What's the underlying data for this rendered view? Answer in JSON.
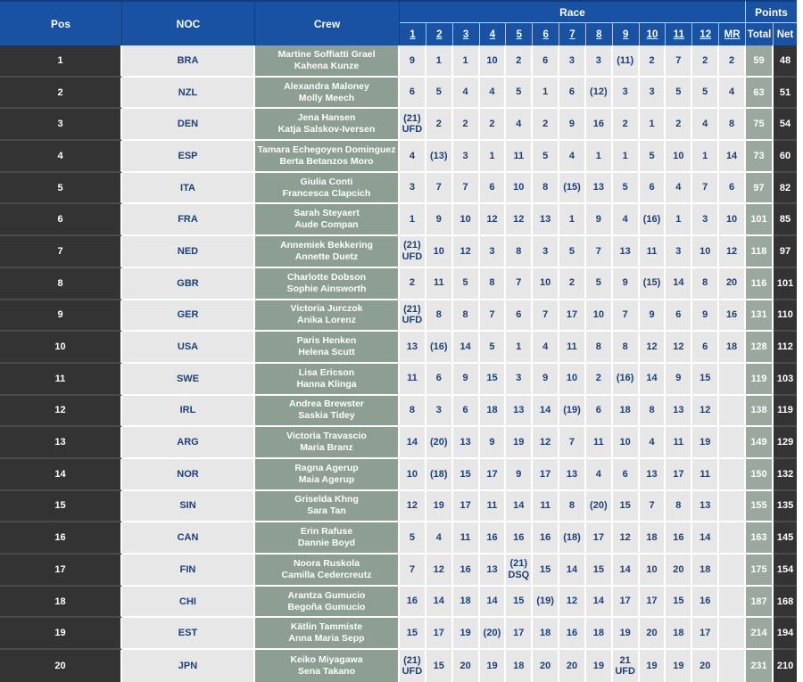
{
  "colors": {
    "header_blue": "#1951a3",
    "header_blue_dark": "#143d7d",
    "dark_cell": "#333333",
    "dark_divider": "#4b4b4b",
    "light_cell": "#e7e7e7",
    "crew_green": "#8d9e92",
    "total_green": "#9aa89d",
    "navy_text": "#1d4078"
  },
  "header": {
    "pos": "Pos",
    "noc": "NOC",
    "crew": "Crew",
    "race": "Race",
    "points": "Points",
    "race_cols": [
      "1",
      "2",
      "3",
      "4",
      "5",
      "6",
      "7",
      "8",
      "9",
      "10",
      "11",
      "12",
      "MR"
    ],
    "total": "Total",
    "net": "Net"
  },
  "rows": [
    {
      "pos": "1",
      "noc": "BRA",
      "crew": [
        "Martine Soffiatti Grael",
        "Kahena Kunze"
      ],
      "races": [
        "9",
        "1",
        "1",
        "10",
        "2",
        "6",
        "3",
        "3",
        "(11)",
        "2",
        "7",
        "2",
        "2"
      ],
      "total": "59",
      "net": "48"
    },
    {
      "pos": "2",
      "noc": "NZL",
      "crew": [
        "Alexandra Maloney",
        "Molly Meech"
      ],
      "races": [
        "6",
        "5",
        "4",
        "4",
        "5",
        "1",
        "6",
        "(12)",
        "3",
        "3",
        "5",
        "5",
        "4"
      ],
      "total": "63",
      "net": "51"
    },
    {
      "pos": "3",
      "noc": "DEN",
      "crew": [
        "Jena Hansen",
        "Katja Salskov-Iversen"
      ],
      "races": [
        "(21)\nUFD",
        "2",
        "2",
        "2",
        "4",
        "2",
        "9",
        "16",
        "2",
        "1",
        "2",
        "4",
        "8"
      ],
      "total": "75",
      "net": "54"
    },
    {
      "pos": "4",
      "noc": "ESP",
      "crew": [
        "Tamara Echegoyen Dominguez",
        "Berta Betanzos Moro"
      ],
      "races": [
        "4",
        "(13)",
        "3",
        "1",
        "11",
        "5",
        "4",
        "1",
        "1",
        "5",
        "10",
        "1",
        "14"
      ],
      "total": "73",
      "net": "60"
    },
    {
      "pos": "5",
      "noc": "ITA",
      "crew": [
        "Giulia Conti",
        "Francesca Clapcich"
      ],
      "races": [
        "3",
        "7",
        "7",
        "6",
        "10",
        "8",
        "(15)",
        "13",
        "5",
        "6",
        "4",
        "7",
        "6"
      ],
      "total": "97",
      "net": "82"
    },
    {
      "pos": "6",
      "noc": "FRA",
      "crew": [
        "Sarah Steyaert",
        "Aude Compan"
      ],
      "races": [
        "1",
        "9",
        "10",
        "12",
        "12",
        "13",
        "1",
        "9",
        "4",
        "(16)",
        "1",
        "3",
        "10"
      ],
      "total": "101",
      "net": "85"
    },
    {
      "pos": "7",
      "noc": "NED",
      "crew": [
        "Annemiek Bekkering",
        "Annette Duetz"
      ],
      "races": [
        "(21)\nUFD",
        "10",
        "12",
        "3",
        "8",
        "3",
        "5",
        "7",
        "13",
        "11",
        "3",
        "10",
        "12"
      ],
      "total": "118",
      "net": "97"
    },
    {
      "pos": "8",
      "noc": "GBR",
      "crew": [
        "Charlotte Dobson",
        "Sophie Ainsworth"
      ],
      "races": [
        "2",
        "11",
        "5",
        "8",
        "7",
        "10",
        "2",
        "5",
        "9",
        "(15)",
        "14",
        "8",
        "20"
      ],
      "total": "116",
      "net": "101"
    },
    {
      "pos": "9",
      "noc": "GER",
      "crew": [
        "Victoria Jurczok",
        "Anika Lorenz"
      ],
      "races": [
        "(21)\nUFD",
        "8",
        "8",
        "7",
        "6",
        "7",
        "17",
        "10",
        "7",
        "9",
        "6",
        "9",
        "16"
      ],
      "total": "131",
      "net": "110"
    },
    {
      "pos": "10",
      "noc": "USA",
      "crew": [
        "Paris Henken",
        "Helena Scutt"
      ],
      "races": [
        "13",
        "(16)",
        "14",
        "5",
        "1",
        "4",
        "11",
        "8",
        "8",
        "12",
        "12",
        "6",
        "18"
      ],
      "total": "128",
      "net": "112"
    },
    {
      "pos": "11",
      "noc": "SWE",
      "crew": [
        "Lisa Ericson",
        "Hanna Klinga"
      ],
      "races": [
        "11",
        "6",
        "9",
        "15",
        "3",
        "9",
        "10",
        "2",
        "(16)",
        "14",
        "9",
        "15",
        ""
      ],
      "total": "119",
      "net": "103"
    },
    {
      "pos": "12",
      "noc": "IRL",
      "crew": [
        "Andrea Brewster",
        "Saskia Tidey"
      ],
      "races": [
        "8",
        "3",
        "6",
        "18",
        "13",
        "14",
        "(19)",
        "6",
        "18",
        "8",
        "13",
        "12",
        ""
      ],
      "total": "138",
      "net": "119"
    },
    {
      "pos": "13",
      "noc": "ARG",
      "crew": [
        "Victoria Travascio",
        "Maria Branz"
      ],
      "races": [
        "14",
        "(20)",
        "13",
        "9",
        "19",
        "12",
        "7",
        "11",
        "10",
        "4",
        "11",
        "19",
        ""
      ],
      "total": "149",
      "net": "129"
    },
    {
      "pos": "14",
      "noc": "NOR",
      "crew": [
        "Ragna Agerup",
        "Maia Agerup"
      ],
      "races": [
        "10",
        "(18)",
        "15",
        "17",
        "9",
        "17",
        "13",
        "4",
        "6",
        "13",
        "17",
        "11",
        ""
      ],
      "total": "150",
      "net": "132"
    },
    {
      "pos": "15",
      "noc": "SIN",
      "crew": [
        "Griselda Khng",
        "Sara Tan"
      ],
      "races": [
        "12",
        "19",
        "17",
        "11",
        "14",
        "11",
        "8",
        "(20)",
        "15",
        "7",
        "8",
        "13",
        ""
      ],
      "total": "155",
      "net": "135"
    },
    {
      "pos": "16",
      "noc": "CAN",
      "crew": [
        "Erin Rafuse",
        "Dannie Boyd"
      ],
      "races": [
        "5",
        "4",
        "11",
        "16",
        "16",
        "16",
        "(18)",
        "17",
        "12",
        "18",
        "16",
        "14",
        ""
      ],
      "total": "163",
      "net": "145"
    },
    {
      "pos": "17",
      "noc": "FIN",
      "crew": [
        "Noora Ruskola",
        "Camilla Cedercreutz"
      ],
      "races": [
        "7",
        "12",
        "16",
        "13",
        "(21)\nDSQ",
        "15",
        "14",
        "15",
        "14",
        "10",
        "20",
        "18",
        ""
      ],
      "total": "175",
      "net": "154"
    },
    {
      "pos": "18",
      "noc": "CHI",
      "crew": [
        "Arantza Gumucio",
        "Begoña Gumucio"
      ],
      "races": [
        "16",
        "14",
        "18",
        "14",
        "15",
        "(19)",
        "12",
        "14",
        "17",
        "17",
        "15",
        "16",
        ""
      ],
      "total": "187",
      "net": "168"
    },
    {
      "pos": "19",
      "noc": "EST",
      "crew": [
        "Kätlin Tammiste",
        "Anna Maria Sepp"
      ],
      "races": [
        "15",
        "17",
        "19",
        "(20)",
        "17",
        "18",
        "16",
        "18",
        "19",
        "20",
        "18",
        "17",
        ""
      ],
      "total": "214",
      "net": "194"
    },
    {
      "pos": "20",
      "noc": "JPN",
      "crew": [
        "Keiko Miyagawa",
        "Sena Takano"
      ],
      "races": [
        "(21)\nUFD",
        "15",
        "20",
        "19",
        "18",
        "20",
        "20",
        "19",
        "21\nUFD",
        "19",
        "19",
        "20",
        ""
      ],
      "total": "231",
      "net": "210"
    }
  ]
}
